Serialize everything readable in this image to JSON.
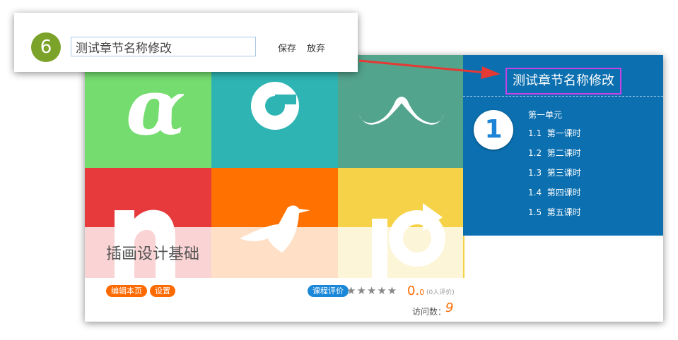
{
  "edit": {
    "step_number": "6",
    "chapter_name_value": "测试章节名称修改",
    "save_label": "保存",
    "cancel_label": "放弃"
  },
  "course": {
    "title": "插画设计基础",
    "tile_colors": [
      "#75dc6f",
      "#2eb5b3",
      "#53a48d",
      "#e63a3d",
      "#ff7100",
      "#f6d248"
    ]
  },
  "panel": {
    "chapter_title": "测试章节名称修改",
    "unit_number": "1",
    "unit_title": "第一单元",
    "lessons": [
      {
        "num": "1.1",
        "title": "第一课时"
      },
      {
        "num": "1.2",
        "title": "第二课时"
      },
      {
        "num": "1.3",
        "title": "第三课时"
      },
      {
        "num": "1.4",
        "title": "第四课时"
      },
      {
        "num": "1.5",
        "title": "第五课时"
      }
    ],
    "accent_color": "#0b6fb0",
    "highlight_color": "#c742e8"
  },
  "footer": {
    "edit_page_label": "编辑本页",
    "settings_label": "设置",
    "rating_label": "课程评价",
    "stars": "★★★★★",
    "score_main": "0.",
    "score_sub": "0",
    "reviews": "(0人评价)",
    "visits_label": "访问数：",
    "visits_value": "9"
  }
}
